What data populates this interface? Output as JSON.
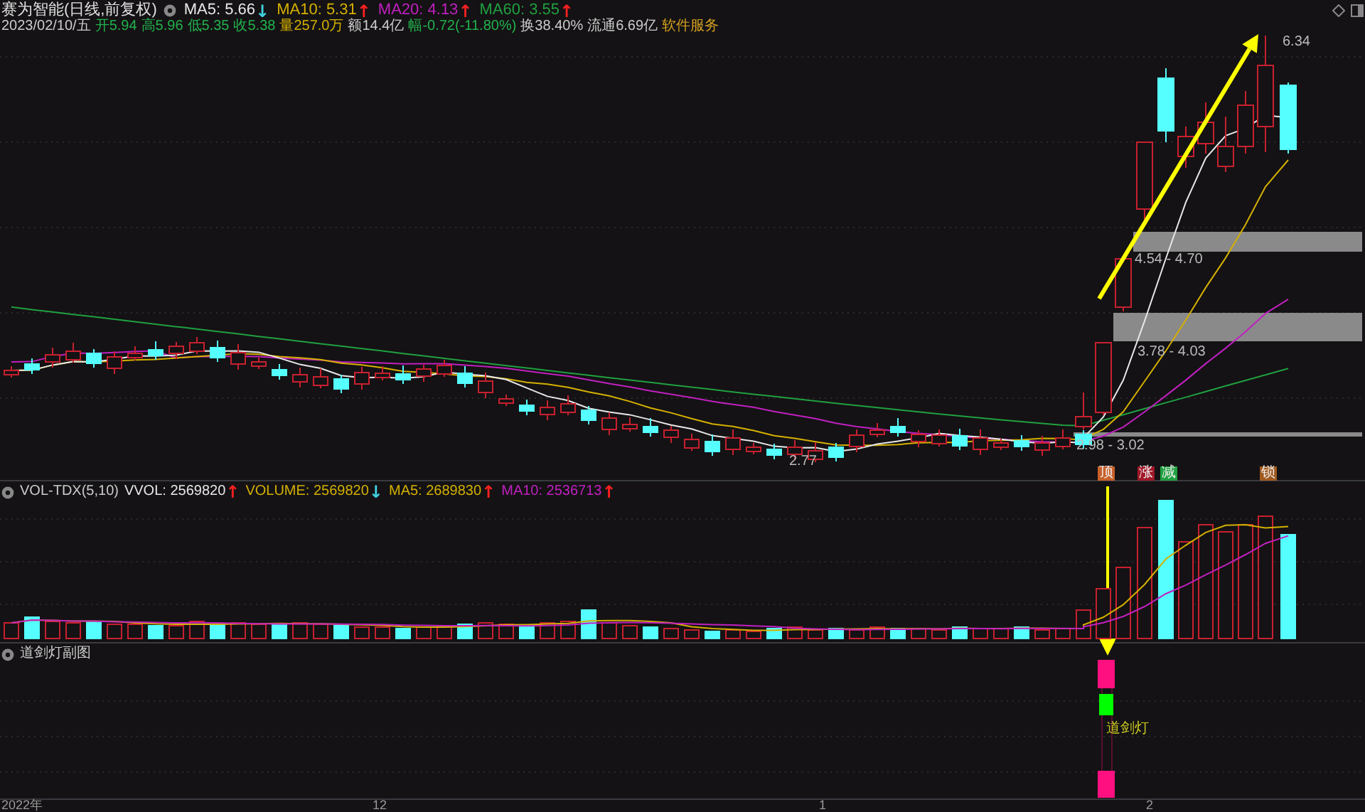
{
  "main_chart": {
    "title": "赛为智能(日线,前复权)",
    "indicators": [
      {
        "label": "MA5: 5.66",
        "color": "#e8e8e8",
        "arrow": {
          "text": "↓",
          "color": "#40d0e0"
        }
      },
      {
        "label": "MA10: 5.31",
        "color": "#d4b000",
        "arrow": {
          "text": "↑",
          "color": "#ff2020"
        }
      },
      {
        "label": "MA20: 4.13",
        "color": "#c020c0",
        "arrow": {
          "text": "↑",
          "color": "#ff2020"
        }
      },
      {
        "label": "MA60: 3.55",
        "color": "#20a040",
        "arrow": {
          "text": "↑",
          "color": "#ff2020"
        }
      }
    ],
    "quote": [
      {
        "text": "2023/02/10/五",
        "color": "#cccccc"
      },
      {
        "text": "开5.94",
        "color": "#22b14c"
      },
      {
        "text": "高5.96",
        "color": "#22b14c"
      },
      {
        "text": "低5.35",
        "color": "#22b14c"
      },
      {
        "text": "收5.38",
        "color": "#22b14c"
      },
      {
        "text": "量257.0万",
        "color": "#d4b000"
      },
      {
        "text": "额14.4亿",
        "color": "#cccccc"
      },
      {
        "text": "幅-0.72(-11.80%)",
        "color": "#22b14c"
      },
      {
        "text": "换38.40%",
        "color": "#cccccc"
      },
      {
        "text": "流通6.69亿",
        "color": "#cccccc"
      },
      {
        "text": "软件服务",
        "color": "#d4a020"
      }
    ],
    "price_labels": [
      {
        "kind": "high",
        "text": "6.34"
      },
      {
        "kind": "low",
        "text": "2.77"
      }
    ],
    "zones": [
      {
        "label": "4.54 - 4.70"
      },
      {
        "label": "3.78 - 4.03"
      },
      {
        "label": "2.98 - 3.02"
      }
    ],
    "signals": [
      {
        "text": "顶",
        "color": "#c8602a"
      },
      {
        "text": "涨",
        "color": "#a01828"
      },
      {
        "text": "减",
        "color": "#20a040"
      },
      {
        "text": "锁",
        "color": "#a05a20"
      }
    ]
  },
  "volume_panel": {
    "title": "VOL-TDX(5,10)",
    "indicators": [
      {
        "label": "VVOL: 2569820",
        "color": "#e8e8e8",
        "arrow": {
          "text": "↑",
          "color": "#ff2020"
        }
      },
      {
        "label": "VOLUME: 2569820",
        "color": "#d4b000",
        "arrow": {
          "text": "↓",
          "color": "#40d0e0"
        }
      },
      {
        "label": "MA5: 2689830",
        "color": "#d4b000",
        "arrow": {
          "text": "↑",
          "color": "#ff2020"
        }
      },
      {
        "label": "MA10: 2536713",
        "color": "#c020c0",
        "arrow": {
          "text": "↑",
          "color": "#ff2020"
        }
      }
    ]
  },
  "signal_panel": {
    "title": "道剑灯副图",
    "label": "道剑灯"
  },
  "x_axis": {
    "labels": [
      "2022年",
      "12",
      "1",
      "2"
    ]
  }
}
